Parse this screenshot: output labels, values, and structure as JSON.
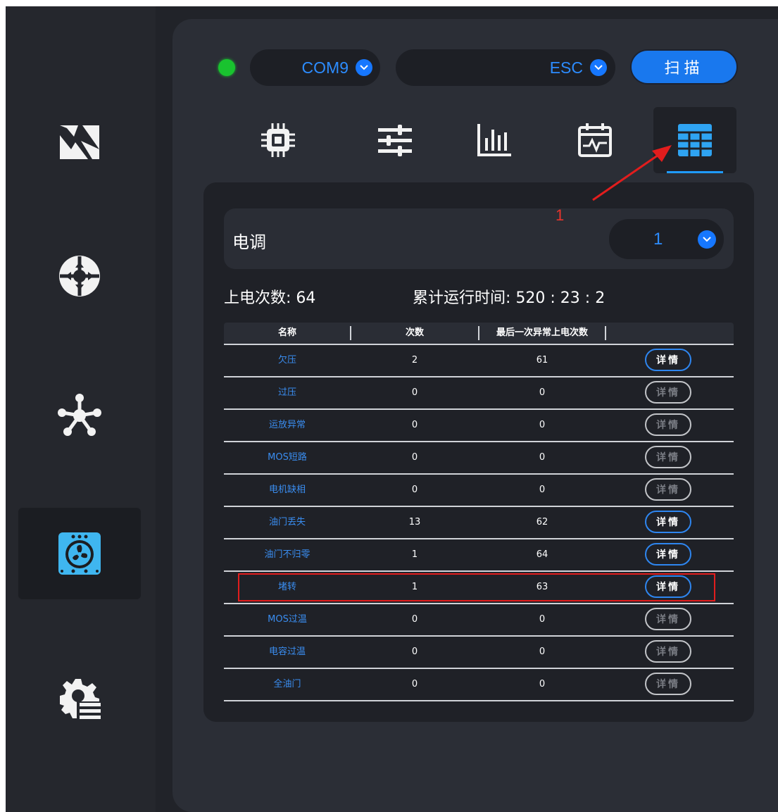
{
  "sidebar": {
    "items": [
      {
        "icon": "photo-icon",
        "active": false
      },
      {
        "icon": "dpad-icon",
        "active": false
      },
      {
        "icon": "network-icon",
        "active": false
      },
      {
        "icon": "fan-icon",
        "active": true
      },
      {
        "icon": "settings-list-icon",
        "active": false
      }
    ]
  },
  "connection": {
    "status_color": "#19c32f",
    "port_value": "COM9",
    "device_value": "ESC",
    "scan_label": "扫描"
  },
  "tabs": [
    {
      "icon": "chip-icon",
      "active": false
    },
    {
      "icon": "sliders-icon",
      "active": false
    },
    {
      "icon": "bar-chart-icon",
      "active": false
    },
    {
      "icon": "waveform-calendar-icon",
      "active": false
    },
    {
      "icon": "table-grid-icon",
      "active": true
    }
  ],
  "esc": {
    "label": "电调",
    "selected": "1"
  },
  "stats": {
    "power_on_count": "上电次数: 64",
    "total_runtime": "累计运行时间: 520 : 23 : 2"
  },
  "table": {
    "headers": [
      "名称",
      "次数",
      "最后一次异常上电次数"
    ],
    "detail_label": "详情",
    "rows": [
      {
        "name": "欠压",
        "count": "2",
        "last": "61",
        "detail_enabled": true
      },
      {
        "name": "过压",
        "count": "0",
        "last": "0",
        "detail_enabled": false
      },
      {
        "name": "运放异常",
        "count": "0",
        "last": "0",
        "detail_enabled": false
      },
      {
        "name": "MOS短路",
        "count": "0",
        "last": "0",
        "detail_enabled": false
      },
      {
        "name": "电机缺相",
        "count": "0",
        "last": "0",
        "detail_enabled": false
      },
      {
        "name": "油门丢失",
        "count": "13",
        "last": "62",
        "detail_enabled": true
      },
      {
        "name": "油门不归零",
        "count": "1",
        "last": "64",
        "detail_enabled": true
      },
      {
        "name": "堵转",
        "count": "1",
        "last": "63",
        "detail_enabled": true
      },
      {
        "name": "MOS过温",
        "count": "0",
        "last": "0",
        "detail_enabled": false
      },
      {
        "name": "电容过温",
        "count": "0",
        "last": "0",
        "detail_enabled": false
      },
      {
        "name": "全油门",
        "count": "0",
        "last": "0",
        "detail_enabled": false
      }
    ]
  },
  "annotation": {
    "number": "1",
    "color": "#e21d1d"
  }
}
